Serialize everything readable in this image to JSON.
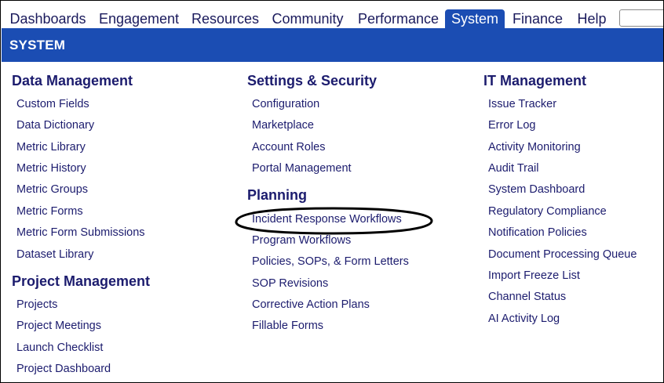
{
  "nav": {
    "tabs": [
      "Dashboards",
      "Engagement",
      "Resources",
      "Community",
      "Performance",
      "System",
      "Finance",
      "Help"
    ],
    "active": "System",
    "search_value": ""
  },
  "section": {
    "title": "SYSTEM"
  },
  "columns": [
    {
      "groups": [
        {
          "title": "Data Management",
          "items": [
            "Custom Fields",
            "Data Dictionary",
            "Metric Library",
            "Metric History",
            "Metric Groups",
            "Metric Forms",
            "Metric Form Submissions",
            "Dataset Library"
          ]
        },
        {
          "title": "Project Management",
          "items": [
            "Projects",
            "Project Meetings",
            "Launch Checklist",
            "Project Dashboard"
          ]
        }
      ]
    },
    {
      "groups": [
        {
          "title": "Settings & Security",
          "items": [
            "Configuration",
            "Marketplace",
            "Account Roles",
            "Portal Management"
          ]
        },
        {
          "title": "Planning",
          "items": [
            "Incident Response Workflows",
            "Program Workflows",
            "Policies, SOPs, & Form Letters",
            "SOP Revisions",
            "Corrective Action Plans",
            "Fillable Forms"
          ]
        }
      ]
    },
    {
      "groups": [
        {
          "title": "IT Management",
          "items": [
            "Issue Tracker",
            "Error Log",
            "Activity Monitoring",
            "Audit Trail",
            "System Dashboard",
            "Regulatory Compliance",
            "Notification Policies",
            "Document Processing Queue",
            "Import Freeze List",
            "Channel Status",
            "AI Activity Log"
          ]
        }
      ]
    }
  ],
  "highlight": {
    "item": "Incident Response Workflows",
    "color": "#000000"
  },
  "colors": {
    "accent": "#1b4db3",
    "link": "#1c1c6e",
    "header_text": "#ffffff"
  }
}
